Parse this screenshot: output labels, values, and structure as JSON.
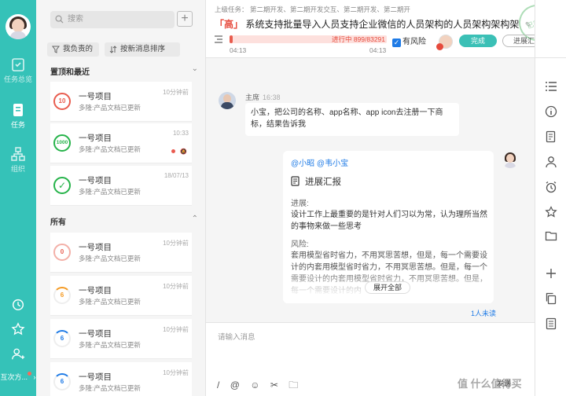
{
  "nav": {
    "items": [
      {
        "label": "任务总览"
      },
      {
        "label": "任务"
      },
      {
        "label": "组织"
      }
    ],
    "more_label": "互次方..."
  },
  "list": {
    "search_placeholder": "搜索",
    "filters": [
      {
        "label": "我负责的"
      },
      {
        "label": "按新消息排序"
      }
    ],
    "sections": [
      {
        "label": "置顶和最近"
      },
      {
        "label": "所有"
      }
    ],
    "cards": [
      {
        "progress": "10",
        "title": "一号项目",
        "sub": "多隆:产品文档已更新",
        "time": "10分钟前",
        "color": "#e85c4e"
      },
      {
        "progress": "1000",
        "title": "一号项目",
        "sub": "多隆:产品文档已更新",
        "time": "10:33",
        "color": "#26b34a"
      },
      {
        "progress": "✓",
        "title": "一号项目",
        "sub": "多隆:产品文档已更新",
        "time": "18/07/13",
        "color": "#26b34a"
      },
      {
        "progress": "0",
        "title": "一号项目",
        "sub": "多隆:产品文档已更新",
        "time": "10分钟前",
        "color": "#e85c4e"
      },
      {
        "progress": "6",
        "title": "一号项目",
        "sub": "多隆:产品文档已更新",
        "time": "10分钟前",
        "color": "#f59a23"
      },
      {
        "progress": "6",
        "title": "一号项目",
        "sub": "多隆:产品文档已更新",
        "time": "10分钟前",
        "color": "#1f7be6"
      },
      {
        "progress": "6",
        "title": "一号项目",
        "sub": "多隆:产品文档已更新",
        "time": "10分钟前",
        "color": "#1f7be6"
      }
    ]
  },
  "task": {
    "breadcrumb": "上级任务： 第二期开发、第二期开发交互、第二期开发、第二期开",
    "priority": "「高」",
    "title": "系统支持批量导入人员支持企业微信的人员架构的人员架构架构架",
    "stamp": "已完成",
    "status_text": "进行中  899/83291",
    "progress_fraction": 0.02,
    "start_time": "04:13",
    "end_time": "04:13",
    "risk_label": "有风险",
    "done_label": "完成",
    "report_label": "进展汇报"
  },
  "messages": {
    "first": {
      "sender": "主席",
      "time": "16:38",
      "text": "小宝，把公司的名称、app名称、app icon去注册一下商标，结果告诉我"
    },
    "report": {
      "mention": "@小昭 @韦小宝",
      "title": "进展汇报",
      "progress_label": "进展:",
      "progress_text": "设计工作上最重要的是针对人们习以为常，认为理所当然的事物来做一些思考",
      "risk_label": "风险:",
      "risk_text": "套用模型省时省力，不用冥思苦想，但是，每一个需要设计的内套用模型省时省力，不用冥思苦想。但是，每一个需要设计的内套用模型省时省力，不用冥思苦想。但是，每一个需要设计的内",
      "expand_label": "展开全部",
      "unread": "1人未读"
    }
  },
  "input": {
    "placeholder": "请输入消息",
    "tools": [
      "/",
      "@",
      "☺",
      "✂",
      "🗀"
    ],
    "send_label": "发送"
  },
  "watermark": "值  什么值得买"
}
